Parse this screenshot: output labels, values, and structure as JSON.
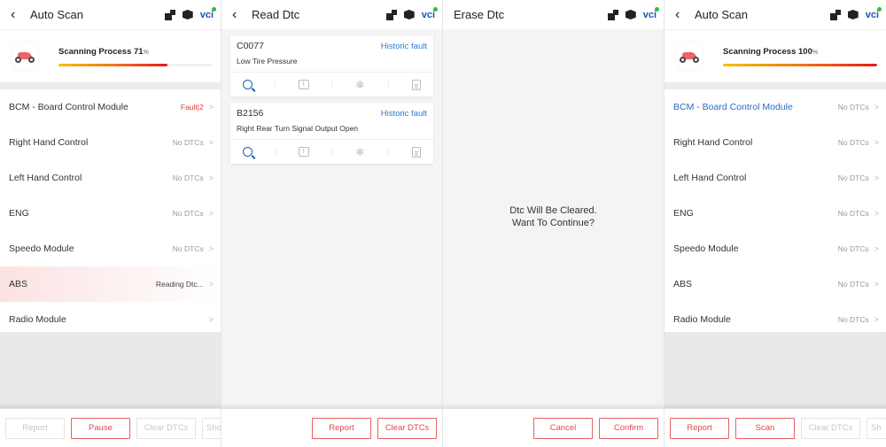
{
  "top_icons": {
    "translate": "translate-icon",
    "box": "box-icon",
    "vci": "vci"
  },
  "screen1": {
    "title": "Auto Scan",
    "scan_label": "Scanning Process 71",
    "pct_symbol": "%",
    "progress": 0.71,
    "modules": [
      {
        "name": "BCM - Board Control Module",
        "status": "Fault|2",
        "state": "fault"
      },
      {
        "name": "Right Hand Control",
        "status": "No DTCs",
        "state": "ok"
      },
      {
        "name": "Left Hand Control",
        "status": "No DTCs",
        "state": "ok"
      },
      {
        "name": "ENG",
        "status": "No DTCs",
        "state": "ok"
      },
      {
        "name": "Speedo Module",
        "status": "No DTCs",
        "state": "ok"
      },
      {
        "name": "ABS",
        "status": "Reading Dtc...",
        "state": "reading"
      },
      {
        "name": "Radio Module",
        "status": "",
        "state": "pending"
      }
    ],
    "buttons": {
      "report": "Report",
      "pause": "Pause",
      "clear": "Clear DTCs",
      "show": "Sho"
    }
  },
  "screen2": {
    "title": "Read Dtc",
    "dtcs": [
      {
        "code": "C0077",
        "type": "Historic fault",
        "desc": "Low Tire Pressure"
      },
      {
        "code": "B2156",
        "type": "Historic fault",
        "desc": "Right Rear Turn Signal Output Open"
      }
    ],
    "buttons": {
      "report": "Report",
      "clear": "Clear DTCs"
    }
  },
  "screen3": {
    "title": "Erase Dtc",
    "message_line1": "Dtc Will Be Cleared.",
    "message_line2": "Want To Continue?",
    "buttons": {
      "cancel": "Cancel",
      "confirm": "Confirm"
    }
  },
  "screen4": {
    "title": "Auto Scan",
    "scan_label": "Scanning Process 100",
    "pct_symbol": "%",
    "progress": 1.0,
    "modules": [
      {
        "name": "BCM - Board Control Module",
        "status": "No DTCs"
      },
      {
        "name": "Right Hand Control",
        "status": "No DTCs"
      },
      {
        "name": "Left Hand Control",
        "status": "No DTCs"
      },
      {
        "name": "ENG",
        "status": "No DTCs"
      },
      {
        "name": "Speedo Module",
        "status": "No DTCs"
      },
      {
        "name": "ABS",
        "status": "No DTCs"
      },
      {
        "name": "Radio Module",
        "status": "No DTCs"
      }
    ],
    "buttons": {
      "report": "Report",
      "scan": "Scan",
      "clear": "Clear DTCs",
      "show": "Sh"
    }
  },
  "colors": {
    "accent_red": "#e04848",
    "link_blue": "#2f7ad8",
    "vci_blue": "#1a56b0",
    "fault_red": "#e83838"
  }
}
